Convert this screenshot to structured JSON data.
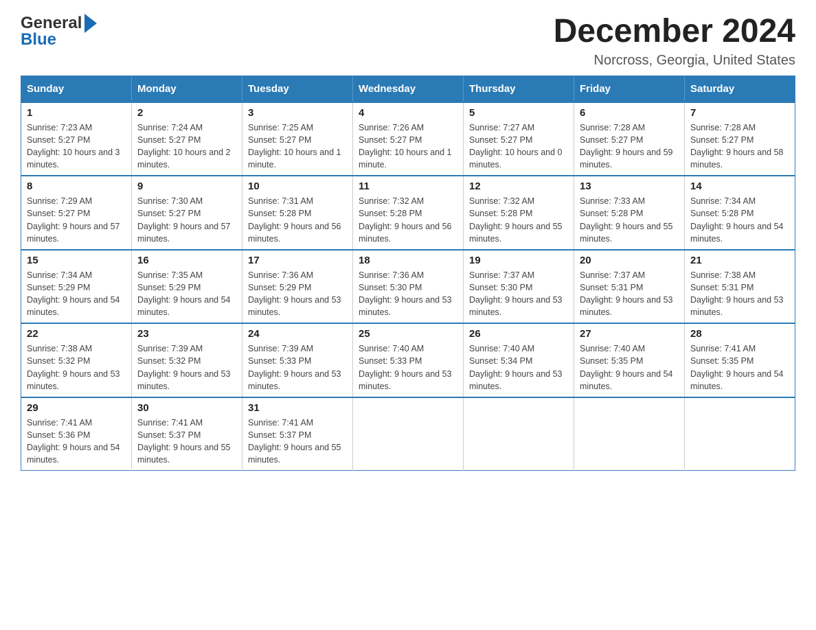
{
  "header": {
    "title": "December 2024",
    "subtitle": "Norcross, Georgia, United States",
    "logo_general": "General",
    "logo_blue": "Blue"
  },
  "weekdays": [
    "Sunday",
    "Monday",
    "Tuesday",
    "Wednesday",
    "Thursday",
    "Friday",
    "Saturday"
  ],
  "weeks": [
    [
      {
        "day": "1",
        "sunrise": "7:23 AM",
        "sunset": "5:27 PM",
        "daylight": "10 hours and 3 minutes."
      },
      {
        "day": "2",
        "sunrise": "7:24 AM",
        "sunset": "5:27 PM",
        "daylight": "10 hours and 2 minutes."
      },
      {
        "day": "3",
        "sunrise": "7:25 AM",
        "sunset": "5:27 PM",
        "daylight": "10 hours and 1 minute."
      },
      {
        "day": "4",
        "sunrise": "7:26 AM",
        "sunset": "5:27 PM",
        "daylight": "10 hours and 1 minute."
      },
      {
        "day": "5",
        "sunrise": "7:27 AM",
        "sunset": "5:27 PM",
        "daylight": "10 hours and 0 minutes."
      },
      {
        "day": "6",
        "sunrise": "7:28 AM",
        "sunset": "5:27 PM",
        "daylight": "9 hours and 59 minutes."
      },
      {
        "day": "7",
        "sunrise": "7:28 AM",
        "sunset": "5:27 PM",
        "daylight": "9 hours and 58 minutes."
      }
    ],
    [
      {
        "day": "8",
        "sunrise": "7:29 AM",
        "sunset": "5:27 PM",
        "daylight": "9 hours and 57 minutes."
      },
      {
        "day": "9",
        "sunrise": "7:30 AM",
        "sunset": "5:27 PM",
        "daylight": "9 hours and 57 minutes."
      },
      {
        "day": "10",
        "sunrise": "7:31 AM",
        "sunset": "5:28 PM",
        "daylight": "9 hours and 56 minutes."
      },
      {
        "day": "11",
        "sunrise": "7:32 AM",
        "sunset": "5:28 PM",
        "daylight": "9 hours and 56 minutes."
      },
      {
        "day": "12",
        "sunrise": "7:32 AM",
        "sunset": "5:28 PM",
        "daylight": "9 hours and 55 minutes."
      },
      {
        "day": "13",
        "sunrise": "7:33 AM",
        "sunset": "5:28 PM",
        "daylight": "9 hours and 55 minutes."
      },
      {
        "day": "14",
        "sunrise": "7:34 AM",
        "sunset": "5:28 PM",
        "daylight": "9 hours and 54 minutes."
      }
    ],
    [
      {
        "day": "15",
        "sunrise": "7:34 AM",
        "sunset": "5:29 PM",
        "daylight": "9 hours and 54 minutes."
      },
      {
        "day": "16",
        "sunrise": "7:35 AM",
        "sunset": "5:29 PM",
        "daylight": "9 hours and 54 minutes."
      },
      {
        "day": "17",
        "sunrise": "7:36 AM",
        "sunset": "5:29 PM",
        "daylight": "9 hours and 53 minutes."
      },
      {
        "day": "18",
        "sunrise": "7:36 AM",
        "sunset": "5:30 PM",
        "daylight": "9 hours and 53 minutes."
      },
      {
        "day": "19",
        "sunrise": "7:37 AM",
        "sunset": "5:30 PM",
        "daylight": "9 hours and 53 minutes."
      },
      {
        "day": "20",
        "sunrise": "7:37 AM",
        "sunset": "5:31 PM",
        "daylight": "9 hours and 53 minutes."
      },
      {
        "day": "21",
        "sunrise": "7:38 AM",
        "sunset": "5:31 PM",
        "daylight": "9 hours and 53 minutes."
      }
    ],
    [
      {
        "day": "22",
        "sunrise": "7:38 AM",
        "sunset": "5:32 PM",
        "daylight": "9 hours and 53 minutes."
      },
      {
        "day": "23",
        "sunrise": "7:39 AM",
        "sunset": "5:32 PM",
        "daylight": "9 hours and 53 minutes."
      },
      {
        "day": "24",
        "sunrise": "7:39 AM",
        "sunset": "5:33 PM",
        "daylight": "9 hours and 53 minutes."
      },
      {
        "day": "25",
        "sunrise": "7:40 AM",
        "sunset": "5:33 PM",
        "daylight": "9 hours and 53 minutes."
      },
      {
        "day": "26",
        "sunrise": "7:40 AM",
        "sunset": "5:34 PM",
        "daylight": "9 hours and 53 minutes."
      },
      {
        "day": "27",
        "sunrise": "7:40 AM",
        "sunset": "5:35 PM",
        "daylight": "9 hours and 54 minutes."
      },
      {
        "day": "28",
        "sunrise": "7:41 AM",
        "sunset": "5:35 PM",
        "daylight": "9 hours and 54 minutes."
      }
    ],
    [
      {
        "day": "29",
        "sunrise": "7:41 AM",
        "sunset": "5:36 PM",
        "daylight": "9 hours and 54 minutes."
      },
      {
        "day": "30",
        "sunrise": "7:41 AM",
        "sunset": "5:37 PM",
        "daylight": "9 hours and 55 minutes."
      },
      {
        "day": "31",
        "sunrise": "7:41 AM",
        "sunset": "5:37 PM",
        "daylight": "9 hours and 55 minutes."
      },
      null,
      null,
      null,
      null
    ]
  ]
}
